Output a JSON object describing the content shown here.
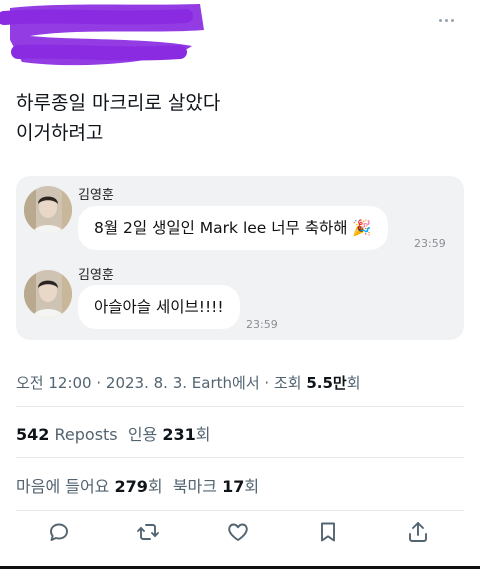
{
  "tweet": {
    "text_line1": "하루종일 마크리로 살았다",
    "text_line2": "이거하려고"
  },
  "chat": {
    "messages": [
      {
        "sender": "김영훈",
        "text": "8월 2일 생일인 Mark lee 너무 축하해 🎉",
        "time": "23:59"
      },
      {
        "sender": "김영훈",
        "text": "아슬아슬 세이브!!!!",
        "time": "23:59"
      }
    ]
  },
  "meta": {
    "datetime": "오전 12:00 · 2023. 8. 3.",
    "source": "Earth에서",
    "views_label": "조회",
    "views_count": "5.5만",
    "views_suffix": "회"
  },
  "stats": {
    "reposts_count": "542",
    "reposts_label": "Reposts",
    "quotes_label": "인용",
    "quotes_count": "231",
    "quotes_suffix": "회",
    "likes_label": "마음에 들어요",
    "likes_count": "279",
    "likes_suffix": "회",
    "bookmarks_label": "북마크",
    "bookmarks_count": "17",
    "bookmarks_suffix": "회"
  },
  "icons": {
    "reply": "reply-icon",
    "repost": "repost-icon",
    "like": "heart-icon",
    "bookmark": "bookmark-icon",
    "share": "share-icon",
    "more": "more-icon"
  },
  "colors": {
    "scribble": "#8a2be2",
    "secondary_text": "#536471",
    "chat_background": "#f1f2f4"
  }
}
